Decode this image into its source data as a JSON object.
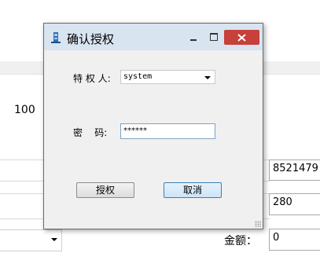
{
  "background": {
    "value_100": "100",
    "field_number": "8521479",
    "field_280": "280",
    "amount_label": "金额：",
    "amount_value": "0"
  },
  "dialog": {
    "title": "确认授权",
    "grantor_label": "特 权 人:",
    "grantor_value": "system",
    "password_label": "密    码:",
    "password_mask": "******",
    "grant_button": "授权",
    "cancel_button": "取消"
  },
  "colors": {
    "titlebar": "#d9e4f1",
    "close_button": "#c7403a",
    "dialog_body": "#f0f0f0"
  },
  "icons": {
    "app": "app-icon",
    "minimize": "minimize-icon",
    "maximize": "maximize-icon",
    "close": "close-icon",
    "dropdown": "chevron-down-icon"
  }
}
